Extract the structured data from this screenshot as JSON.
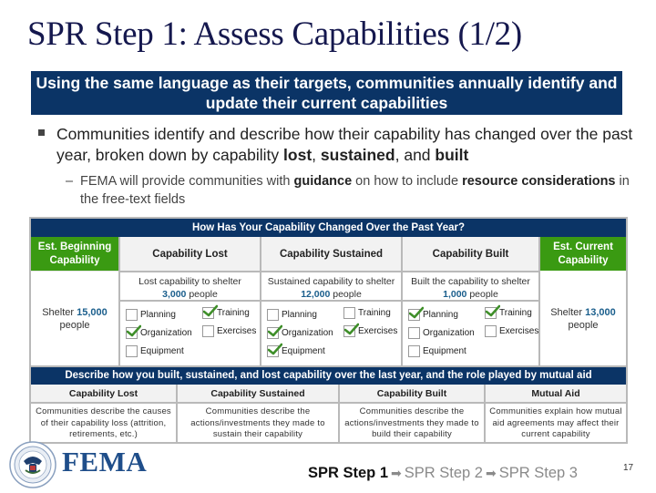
{
  "slide": {
    "title": "SPR Step 1: Assess Capabilities (1/2)",
    "banner": "Using the same language as their targets, communities annually identify and update their current capabilities",
    "bullet1": {
      "prefix": "Communities identify and describe how their capability has changed over the past year, broken down by capability ",
      "bold1": "lost",
      "sep1": ", ",
      "bold2": "sustained",
      "sep2": ", and ",
      "bold3": "built"
    },
    "bullet2": {
      "dash": "–",
      "part1": "FEMA will provide communities with ",
      "bold1": "guidance",
      "part2": " on how to include ",
      "bold2": "resource considerations",
      "part3": " in the free-text fields"
    },
    "page_number": "17"
  },
  "table1": {
    "header": "How Has Your Capability Changed Over the Past Year?",
    "est_beginning_label": "Est. Beginning Capability",
    "est_current_label": "Est. Current Capability",
    "columns": [
      {
        "label": "Capability Lost",
        "desc_pre": "Lost capability to shelter",
        "value": "3,000",
        "desc_post": "people",
        "checkboxes": [
          {
            "label": "Planning",
            "checked": false
          },
          {
            "label": "Training",
            "checked": true
          },
          {
            "label": "Organization",
            "checked": true
          },
          {
            "label": "Exercises",
            "checked": false
          },
          {
            "label": "Equipment",
            "checked": false
          }
        ]
      },
      {
        "label": "Capability Sustained",
        "desc_pre": "Sustained capability to shelter",
        "value": "12,000",
        "desc_post": "people",
        "checkboxes": [
          {
            "label": "Planning",
            "checked": false
          },
          {
            "label": "Training",
            "checked": false
          },
          {
            "label": "Organization",
            "checked": true
          },
          {
            "label": "Exercises",
            "checked": true
          },
          {
            "label": "Equipment",
            "checked": true
          }
        ]
      },
      {
        "label": "Capability Built",
        "desc_pre": "Built the capability to shelter",
        "value": "1,000",
        "desc_post": "people",
        "checkboxes": [
          {
            "label": "Planning",
            "checked": true
          },
          {
            "label": "Training",
            "checked": true
          },
          {
            "label": "Organization",
            "checked": false
          },
          {
            "label": "Exercises",
            "checked": false
          },
          {
            "label": "Equipment",
            "checked": false
          }
        ]
      }
    ],
    "beginning": {
      "pre": "Shelter",
      "value": "15,000",
      "post": "people"
    },
    "current": {
      "pre": "Shelter",
      "value": "13,000",
      "post": "people"
    }
  },
  "table2": {
    "header": "Describe how you built, sustained, and lost capability over the last year, and the role played by mutual aid",
    "columns": [
      {
        "label": "Capability Lost",
        "desc": "Communities describe the causes of their capability loss (attrition, retirements, etc.)"
      },
      {
        "label": "Capability Sustained",
        "desc": "Communities describe the actions/investments they made to sustain their capability"
      },
      {
        "label": "Capability Built",
        "desc": "Communities describe the actions/investments they made to build their capability"
      },
      {
        "label": "Mutual Aid",
        "desc": "Communities explain how mutual aid agreements may affect their current capability"
      }
    ]
  },
  "footer": {
    "logo_text": "FEMA",
    "logo_icon": "dhs-seal-icon",
    "steps": [
      {
        "label": "SPR Step 1",
        "active": true
      },
      {
        "label": "SPR Step 2",
        "active": false
      },
      {
        "label": "SPR Step 3",
        "active": false
      }
    ],
    "arrow": "➡"
  },
  "colors": {
    "navy": "#0b3466",
    "green": "#3a9a12",
    "number_blue": "#1a5e8c",
    "title": "#15184e"
  }
}
